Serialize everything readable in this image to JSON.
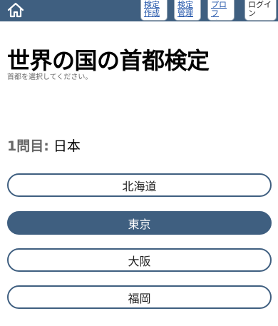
{
  "header": {
    "home_icon": "home-icon",
    "nav": [
      {
        "label": "検定\n作成"
      },
      {
        "label": "検定\n管理"
      },
      {
        "label": "プロフ\nィール"
      },
      {
        "label": "ログイ\nン"
      }
    ]
  },
  "main": {
    "title": "世界の国の首都検定",
    "subtitle": "首都を選択してください。",
    "question": {
      "number_label": "1問目:",
      "text": "日本"
    },
    "choices": [
      {
        "label": "北海道",
        "selected": false
      },
      {
        "label": "東京",
        "selected": true
      },
      {
        "label": "大阪",
        "selected": false
      },
      {
        "label": "福岡",
        "selected": false
      }
    ]
  },
  "colors": {
    "accent": "#3f5f80",
    "link": "#2255aa"
  }
}
